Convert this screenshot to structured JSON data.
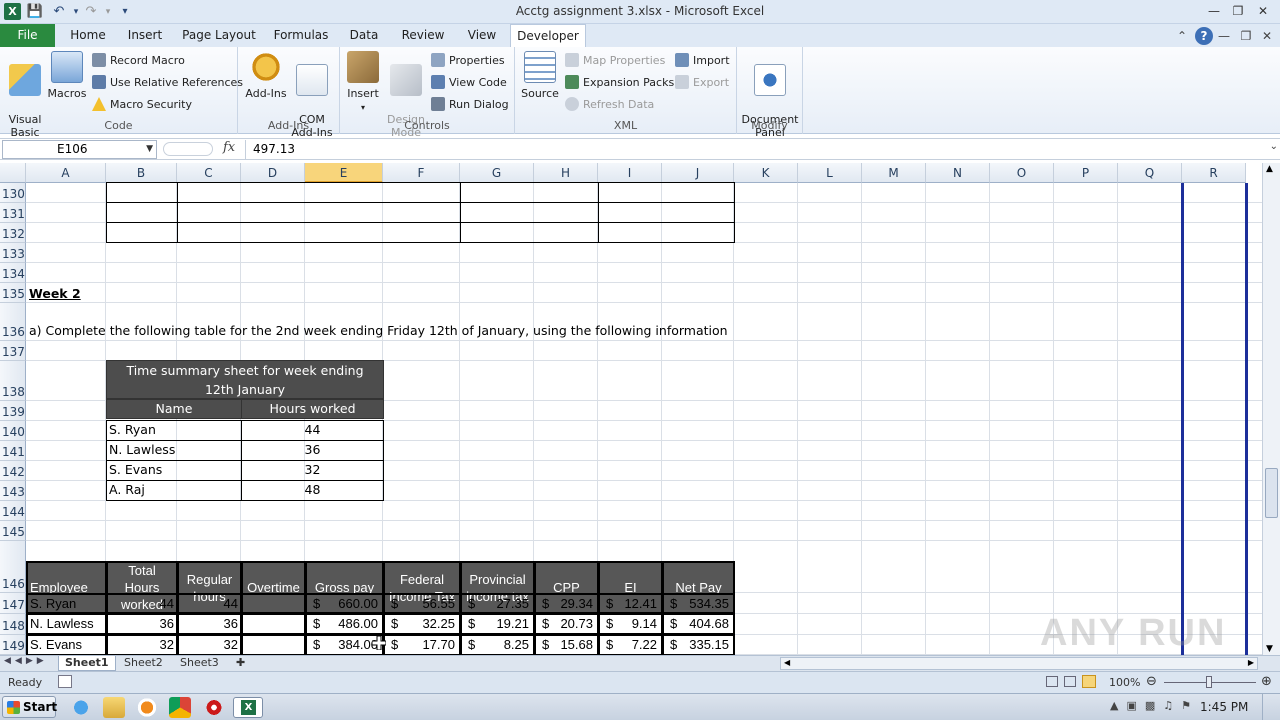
{
  "window": {
    "title": "Acctg assignment 3.xlsx -  Microsoft Excel",
    "app_icon": "X"
  },
  "tabs": [
    "File",
    "Home",
    "Insert",
    "Page Layout",
    "Formulas",
    "Data",
    "Review",
    "View",
    "Developer"
  ],
  "active_tab": "Developer",
  "ribbon": {
    "code": {
      "label": "Code",
      "visual_basic": "Visual\nBasic",
      "macros": "Macros",
      "record_macro": "Record Macro",
      "use_relative": "Use Relative References",
      "macro_security": "Macro Security"
    },
    "addins": {
      "label": "Add-Ins",
      "addins": "Add-Ins",
      "com": "COM\nAdd-Ins"
    },
    "controls": {
      "label": "Controls",
      "insert": "Insert",
      "design_mode": "Design\nMode",
      "properties": "Properties",
      "view_code": "View Code",
      "run_dialog": "Run Dialog"
    },
    "xml": {
      "label": "XML",
      "source": "Source",
      "map_properties": "Map Properties",
      "expansion_packs": "Expansion Packs",
      "refresh_data": "Refresh Data",
      "import": "Import",
      "export": "Export"
    },
    "modify": {
      "label": "Modify",
      "document_panel": "Document\nPanel"
    }
  },
  "formula_bar": {
    "name_box": "E106",
    "fx": "fx",
    "value": "497.13"
  },
  "columns": [
    "A",
    "B",
    "C",
    "D",
    "E",
    "F",
    "G",
    "H",
    "I",
    "J",
    "K",
    "L",
    "M",
    "N",
    "O",
    "P",
    "Q",
    "R"
  ],
  "selected_column": "E",
  "rows": [
    "130",
    "131",
    "132",
    "133",
    "134",
    "135",
    "136",
    "137",
    "138",
    "139",
    "140",
    "141",
    "142",
    "143",
    "144",
    "145",
    "146",
    "147",
    "148",
    "149"
  ],
  "sheet": {
    "week_heading": "Week 2",
    "instruction": "a) Complete the following table for the 2nd week ending Friday 12th of January, using the following information",
    "time_summary": {
      "title_line1": "Time summary sheet for week ending",
      "title_line2": "12th January",
      "col_name": "Name",
      "col_hours": "Hours worked",
      "rows": [
        {
          "name": "S. Ryan",
          "hours": "44"
        },
        {
          "name": "N. Lawless",
          "hours": "36"
        },
        {
          "name": "S. Evans",
          "hours": "32"
        },
        {
          "name": "A. Raj",
          "hours": "48"
        }
      ]
    },
    "payroll": {
      "headers": [
        "Employee",
        "Total Hours\nworked",
        "Regular\nhours",
        "Overtime",
        "Gross pay",
        "Federal\nIncome Tax",
        "Provincial\nincome tax",
        "CPP",
        "EI",
        "Net Pay"
      ],
      "rows": [
        {
          "employee": "S. Ryan",
          "total": "44",
          "regular": "44",
          "overtime": "",
          "gross": "660.00",
          "federal": "56.55",
          "provincial": "27.35",
          "cpp": "29.34",
          "ei": "12.41",
          "net": "534.35"
        },
        {
          "employee": "N. Lawless",
          "total": "36",
          "regular": "36",
          "overtime": "",
          "gross": "486.00",
          "federal": "32.25",
          "provincial": "19.21",
          "cpp": "20.73",
          "ei": "9.14",
          "net": "404.68"
        },
        {
          "employee": "S. Evans",
          "total": "32",
          "regular": "32",
          "overtime": "",
          "gross": "384.00",
          "federal": "17.70",
          "provincial": "8.25",
          "cpp": "15.68",
          "ei": "7.22",
          "net": "335.15"
        }
      ],
      "currency": "$"
    }
  },
  "sheet_tabs": [
    "Sheet1",
    "Sheet2",
    "Sheet3"
  ],
  "active_sheet": "Sheet1",
  "status": {
    "ready": "Ready",
    "zoom": "100%"
  },
  "taskbar": {
    "start": "Start",
    "clock": "1:45 PM"
  },
  "watermark": "ANY RUN"
}
